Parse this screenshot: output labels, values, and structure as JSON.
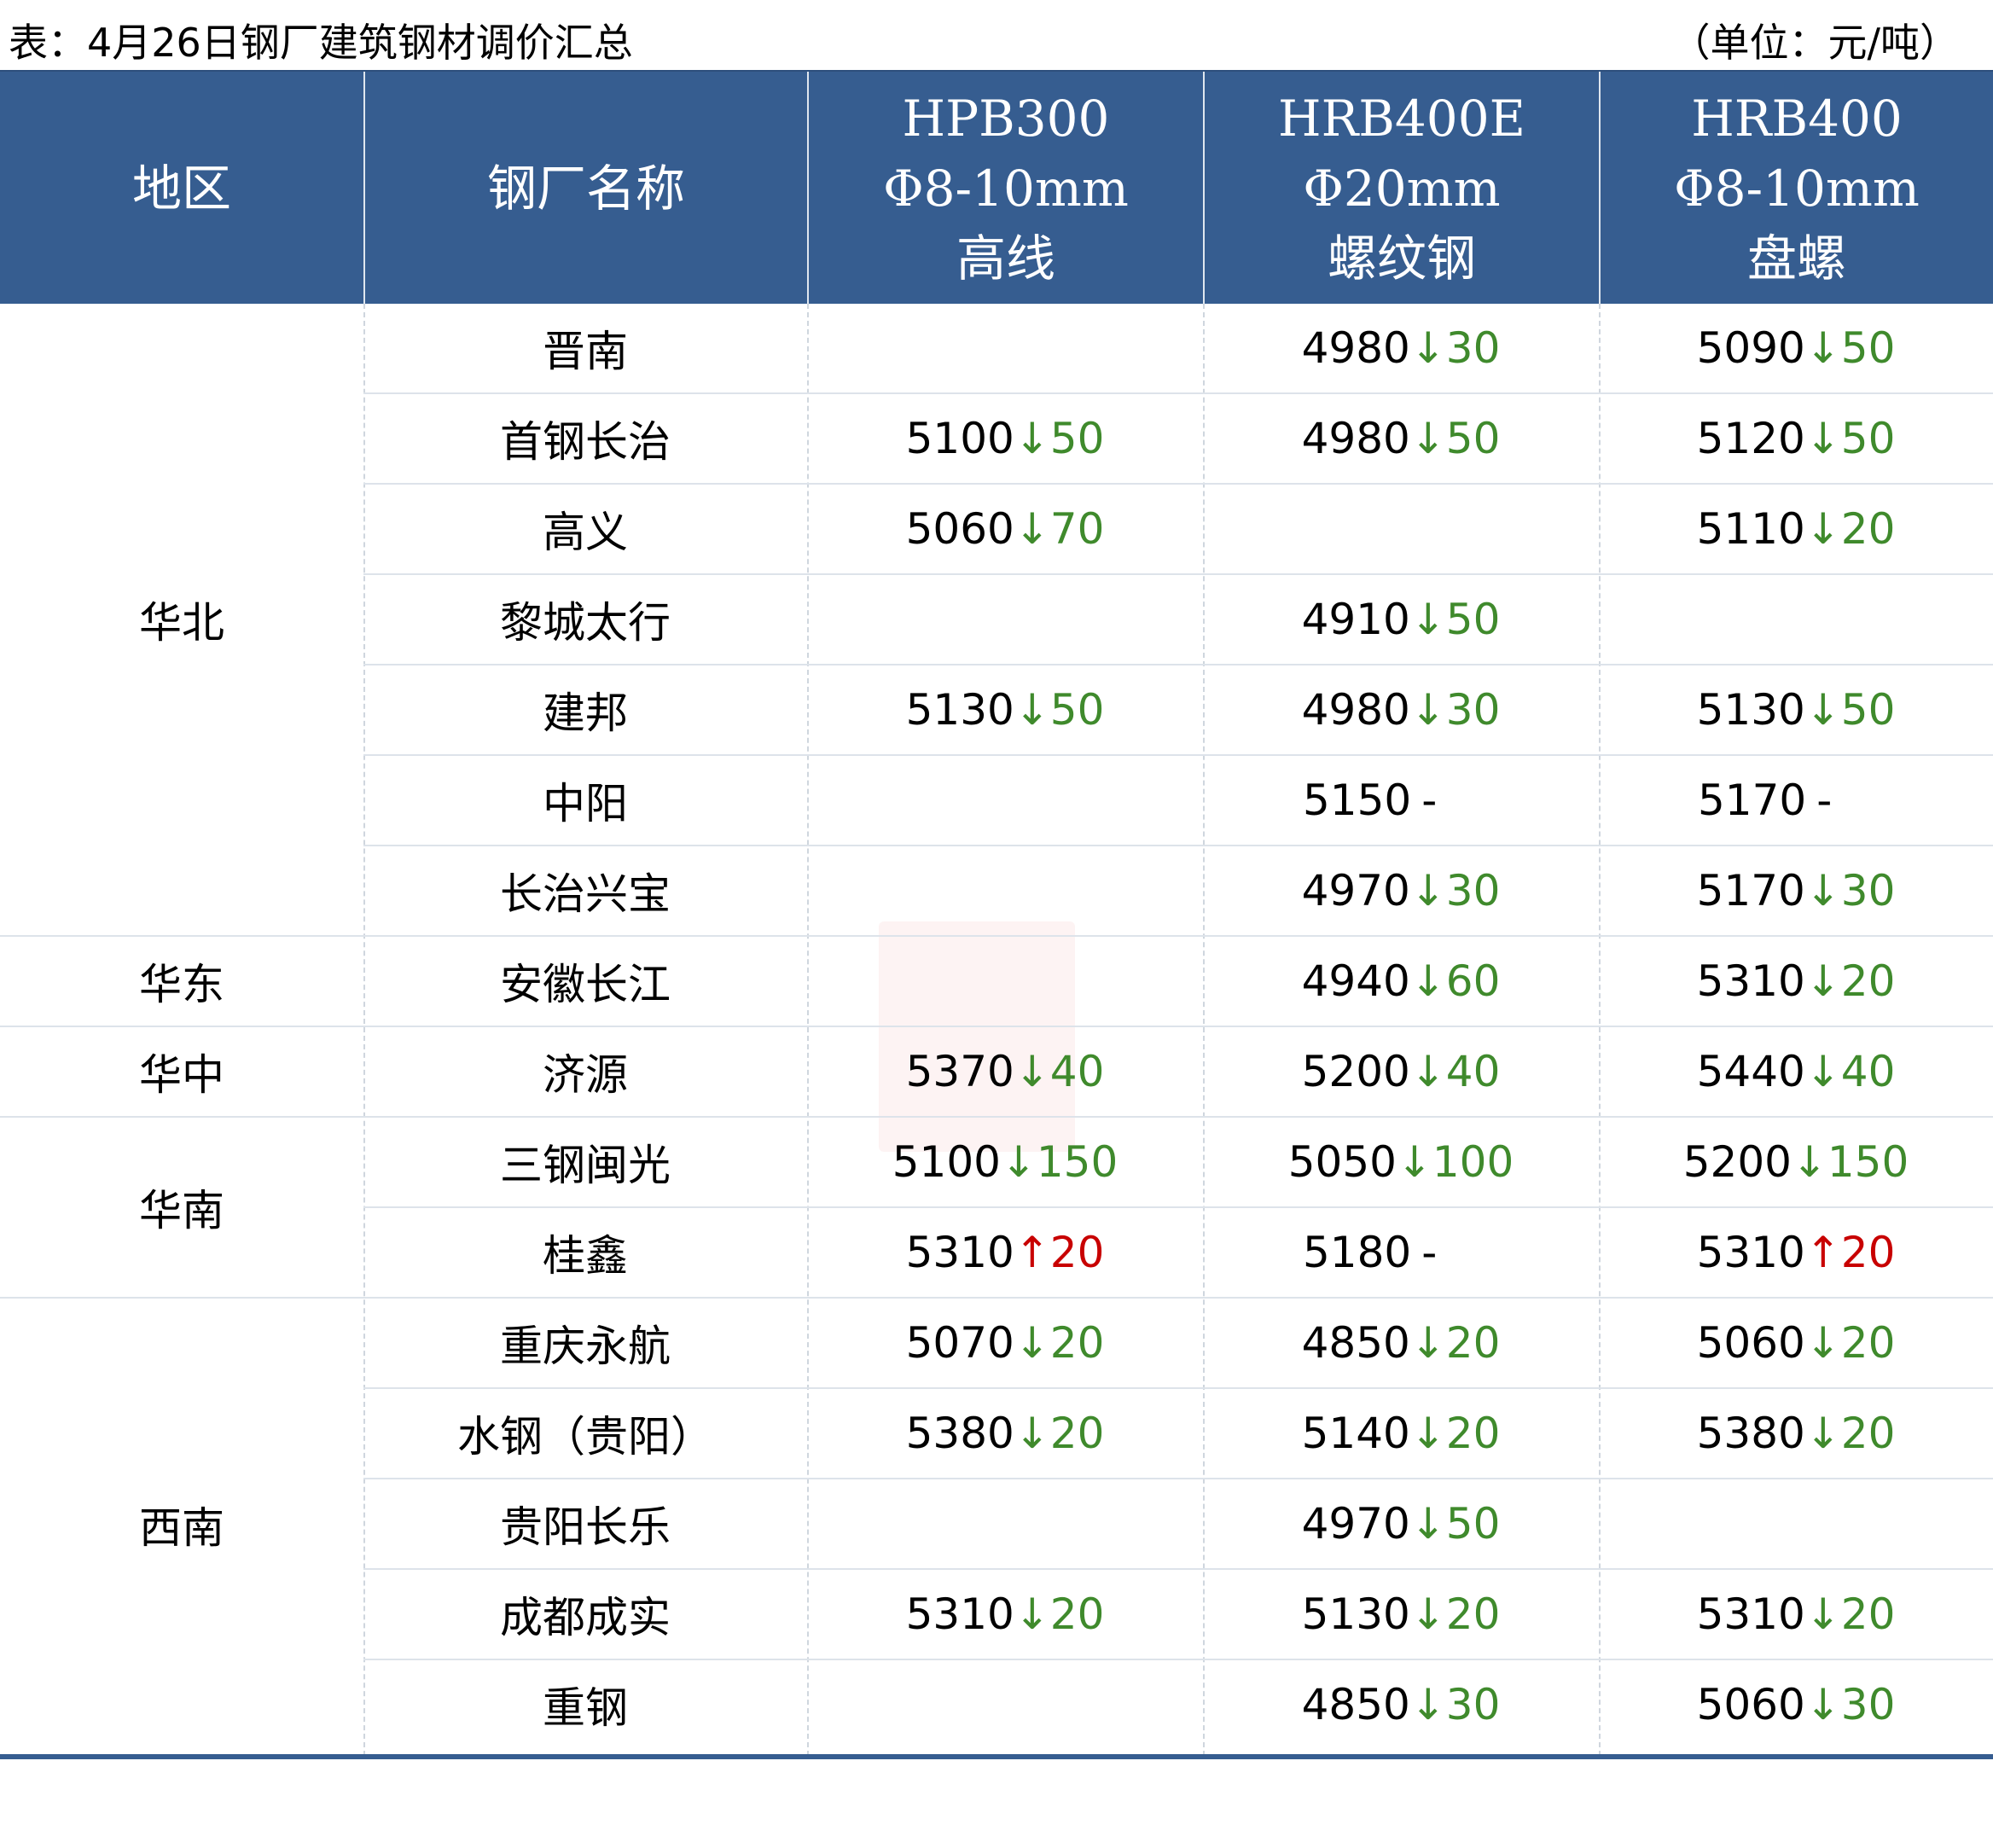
{
  "caption": {
    "title": "表：4月26日钢厂建筑钢材调价汇总",
    "unit": "（单位：元/吨）"
  },
  "header": {
    "region": "地区",
    "mill": "钢厂名称",
    "col1": [
      "HPB300",
      "Φ8-10mm",
      "高线"
    ],
    "col2": [
      "HRB400E",
      "Φ20mm",
      "螺纹钢"
    ],
    "col3": [
      "HRB400",
      "Φ8-10mm",
      "盘螺"
    ]
  },
  "colors": {
    "header_bg": "#365d90",
    "down": "#3f8a2c",
    "up": "#c80000"
  },
  "regions": [
    {
      "name": "华北",
      "rows": 7
    },
    {
      "name": "华东",
      "rows": 1
    },
    {
      "name": "华中",
      "rows": 1
    },
    {
      "name": "华南",
      "rows": 2
    },
    {
      "name": "西南",
      "rows": 5
    }
  ],
  "rows": [
    {
      "mill": "晋南",
      "cells": [
        null,
        {
          "price": "4980",
          "arrow": "↓",
          "change": "30",
          "dir": "down"
        },
        {
          "price": "5090",
          "arrow": "↓",
          "change": "50",
          "dir": "down"
        }
      ]
    },
    {
      "mill": "首钢长治",
      "cells": [
        {
          "price": "5100",
          "arrow": "↓",
          "change": "50",
          "dir": "down"
        },
        {
          "price": "4980",
          "arrow": "↓",
          "change": "50",
          "dir": "down"
        },
        {
          "price": "5120",
          "arrow": "↓",
          "change": "50",
          "dir": "down"
        }
      ]
    },
    {
      "mill": "高义",
      "cells": [
        {
          "price": "5060",
          "arrow": "↓",
          "change": "70",
          "dir": "down"
        },
        null,
        {
          "price": "5110",
          "arrow": "↓",
          "change": "20",
          "dir": "down"
        }
      ]
    },
    {
      "mill": "黎城太行",
      "cells": [
        null,
        {
          "price": "4910",
          "arrow": "↓",
          "change": "50",
          "dir": "down"
        },
        null
      ]
    },
    {
      "mill": "建邦",
      "cells": [
        {
          "price": "5130",
          "arrow": "↓",
          "change": "50",
          "dir": "down"
        },
        {
          "price": "4980",
          "arrow": "↓",
          "change": "30",
          "dir": "down"
        },
        {
          "price": "5130",
          "arrow": "↓",
          "change": "50",
          "dir": "down"
        }
      ]
    },
    {
      "mill": "中阳",
      "cells": [
        null,
        {
          "price": "5150",
          "arrow": "",
          "change": "-",
          "dir": "flat"
        },
        {
          "price": "5170",
          "arrow": "",
          "change": "-",
          "dir": "flat"
        }
      ]
    },
    {
      "mill": "长治兴宝",
      "cells": [
        null,
        {
          "price": "4970",
          "arrow": "↓",
          "change": "30",
          "dir": "down"
        },
        {
          "price": "5170",
          "arrow": "↓",
          "change": "30",
          "dir": "down"
        }
      ]
    },
    {
      "mill": "安徽长江",
      "cells": [
        null,
        {
          "price": "4940",
          "arrow": "↓",
          "change": "60",
          "dir": "down"
        },
        {
          "price": "5310",
          "arrow": "↓",
          "change": "20",
          "dir": "down"
        }
      ]
    },
    {
      "mill": "济源",
      "cells": [
        {
          "price": "5370",
          "arrow": "↓",
          "change": "40",
          "dir": "down"
        },
        {
          "price": "5200",
          "arrow": "↓",
          "change": "40",
          "dir": "down"
        },
        {
          "price": "5440",
          "arrow": "↓",
          "change": "40",
          "dir": "down"
        }
      ]
    },
    {
      "mill": "三钢闽光",
      "cells": [
        {
          "price": "5100",
          "arrow": "↓",
          "change": "150",
          "dir": "down"
        },
        {
          "price": "5050",
          "arrow": "↓",
          "change": "100",
          "dir": "down"
        },
        {
          "price": "5200",
          "arrow": "↓",
          "change": "150",
          "dir": "down"
        }
      ]
    },
    {
      "mill": "桂鑫",
      "cells": [
        {
          "price": "5310",
          "arrow": "↑",
          "change": "20",
          "dir": "up"
        },
        {
          "price": "5180",
          "arrow": "",
          "change": "-",
          "dir": "flat"
        },
        {
          "price": "5310",
          "arrow": "↑",
          "change": "20",
          "dir": "up"
        }
      ]
    },
    {
      "mill": "重庆永航",
      "cells": [
        {
          "price": "5070",
          "arrow": "↓",
          "change": "20",
          "dir": "down"
        },
        {
          "price": "4850",
          "arrow": "↓",
          "change": "20",
          "dir": "down"
        },
        {
          "price": "5060",
          "arrow": "↓",
          "change": "20",
          "dir": "down"
        }
      ]
    },
    {
      "mill": "水钢（贵阳）",
      "cells": [
        {
          "price": "5380",
          "arrow": "↓",
          "change": "20",
          "dir": "down"
        },
        {
          "price": "5140",
          "arrow": "↓",
          "change": "20",
          "dir": "down"
        },
        {
          "price": "5380",
          "arrow": "↓",
          "change": "20",
          "dir": "down"
        }
      ]
    },
    {
      "mill": "贵阳长乐",
      "cells": [
        null,
        {
          "price": "4970",
          "arrow": "↓",
          "change": "50",
          "dir": "down"
        },
        null
      ]
    },
    {
      "mill": "成都成实",
      "cells": [
        {
          "price": "5310",
          "arrow": "↓",
          "change": "20",
          "dir": "down"
        },
        {
          "price": "5130",
          "arrow": "↓",
          "change": "20",
          "dir": "down"
        },
        {
          "price": "5310",
          "arrow": "↓",
          "change": "20",
          "dir": "down"
        }
      ]
    },
    {
      "mill": "重钢",
      "cells": [
        null,
        {
          "price": "4850",
          "arrow": "↓",
          "change": "30",
          "dir": "down"
        },
        {
          "price": "5060",
          "arrow": "↓",
          "change": "30",
          "dir": "down"
        }
      ]
    }
  ]
}
